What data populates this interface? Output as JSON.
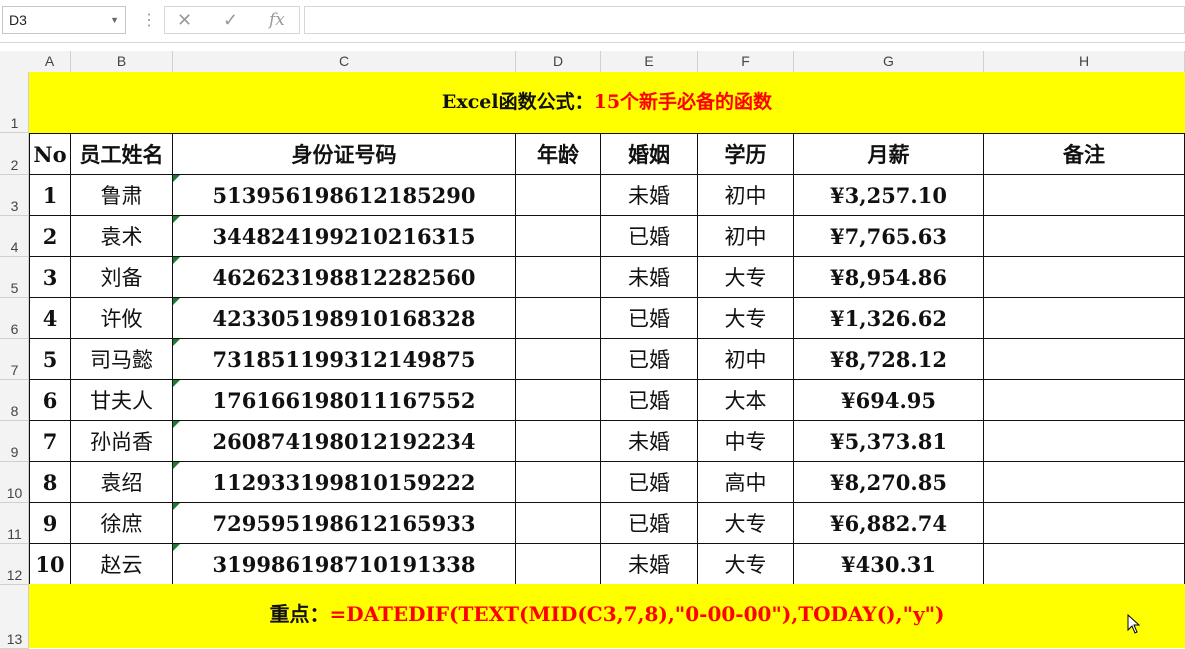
{
  "formula_bar": {
    "name_box": "D3",
    "fx_label": "fx",
    "formula": ""
  },
  "columns": [
    "A",
    "B",
    "C",
    "D",
    "E",
    "F",
    "G",
    "H"
  ],
  "rows": [
    "1",
    "2",
    "3",
    "4",
    "5",
    "6",
    "7",
    "8",
    "9",
    "10",
    "11",
    "12",
    "13"
  ],
  "title": {
    "part1": "Excel函数公式：",
    "part2": "15个新手必备的函数"
  },
  "headers": [
    "No",
    "员工姓名",
    "身份证号码",
    "年龄",
    "婚姻",
    "学历",
    "月薪",
    "备注"
  ],
  "records": [
    [
      "1",
      "鲁肃",
      "513956198612185290",
      "",
      "未婚",
      "初中",
      "¥3,257.10",
      ""
    ],
    [
      "2",
      "袁术",
      "344824199210216315",
      "",
      "已婚",
      "初中",
      "¥7,765.63",
      ""
    ],
    [
      "3",
      "刘备",
      "462623198812282560",
      "",
      "未婚",
      "大专",
      "¥8,954.86",
      ""
    ],
    [
      "4",
      "许攸",
      "423305198910168328",
      "",
      "已婚",
      "大专",
      "¥1,326.62",
      ""
    ],
    [
      "5",
      "司马懿",
      "731851199312149875",
      "",
      "已婚",
      "初中",
      "¥8,728.12",
      ""
    ],
    [
      "6",
      "甘夫人",
      "176166198011167552",
      "",
      "已婚",
      "大本",
      "¥694.95",
      ""
    ],
    [
      "7",
      "孙尚香",
      "260874198012192234",
      "",
      "未婚",
      "中专",
      "¥5,373.81",
      ""
    ],
    [
      "8",
      "袁绍",
      "112933199810159222",
      "",
      "已婚",
      "高中",
      "¥8,270.85",
      ""
    ],
    [
      "9",
      "徐庶",
      "729595198612165933",
      "",
      "已婚",
      "大专",
      "¥6,882.74",
      ""
    ],
    [
      "10",
      "赵云",
      "319986198710191338",
      "",
      "未婚",
      "大专",
      "¥430.31",
      ""
    ]
  ],
  "note": {
    "label": "重点：",
    "formula": "=DATEDIF(TEXT(MID(C3,7,8),\"0-00-00\"),TODAY(),\"y\")"
  }
}
